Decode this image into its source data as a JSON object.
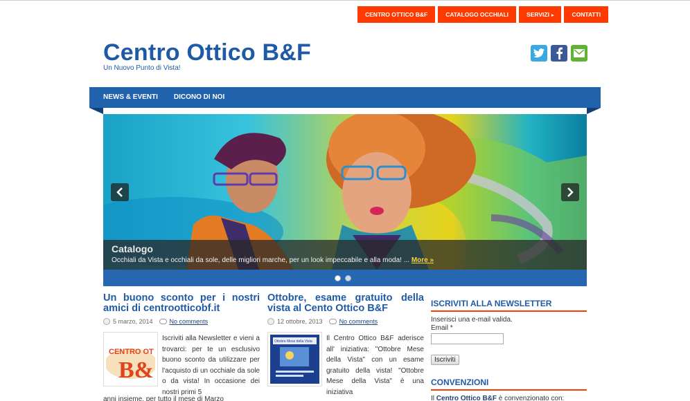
{
  "top_nav": {
    "items": [
      {
        "label": "CENTRO OTTICO B&F"
      },
      {
        "label": "CATALOGO OCCHIALI"
      },
      {
        "label": "SERVIZI",
        "has_submenu": true
      },
      {
        "label": "CONTATTI"
      }
    ],
    "color": "#ff3a00"
  },
  "header": {
    "title": "Centro Ottico B&F",
    "tagline": "Un Nuovo Punto di Vista!",
    "title_color": "#1f5aa6"
  },
  "social": {
    "icons": [
      "twitter-icon",
      "facebook-icon",
      "email-icon"
    ]
  },
  "main_nav": {
    "items": [
      {
        "label": "NEWS & EVENTI"
      },
      {
        "label": "DICONO DI NOI"
      }
    ],
    "color": "#2162ad"
  },
  "slider": {
    "caption_title": "Catalogo",
    "caption_text": "Occhiali da Vista e occhiali da sole, delle migliori marche, per un look impeccabile e alla moda! ...",
    "more_label": "More »",
    "dot_count": 2,
    "active_dot": 1
  },
  "posts": [
    {
      "title": "Un buono sconto per i nostri amici di centrootticobf.it",
      "date": "5 marzo, 2014",
      "comments": "No comments",
      "excerpt": "Iscriviti alla Newsletter e vieni a trovarci: per te un esclusivo buono sconto da utilizzare per l'acquisto di un occhiale da sole o da vista!   In occasione dei nostri primi 5",
      "excerpt_tail": "anni insieme, per tutto il mese di Marzo",
      "thumb_text": "CENTRO OT"
    },
    {
      "title": "Ottobre, esame gratuito della vista al Cento Ottico B&F",
      "date": "12 ottobre, 2013",
      "comments": "No comments",
      "excerpt": "Il Centro Ottico B&F aderisce all' iniziativa: \"Ottobre Mese della Vista\" con un esame gratuito della vista! \"Ottobre Mese della Vista\" è una iniziativa",
      "thumb_text": "Ottobre Mese della Vista"
    }
  ],
  "sidebar": {
    "newsletter": {
      "title": "ISCRIVITI ALLA NEWSLETTER",
      "instruction": "Inserisci una e-mail valida.",
      "email_label": "Email *",
      "email_value": "",
      "button_label": "Iscriviti"
    },
    "convenzioni": {
      "title": "CONVENZIONI",
      "text_pre": "Il ",
      "text_strong": "Centro Ottico B&F",
      "text_post": " è convenzionato con:"
    }
  }
}
